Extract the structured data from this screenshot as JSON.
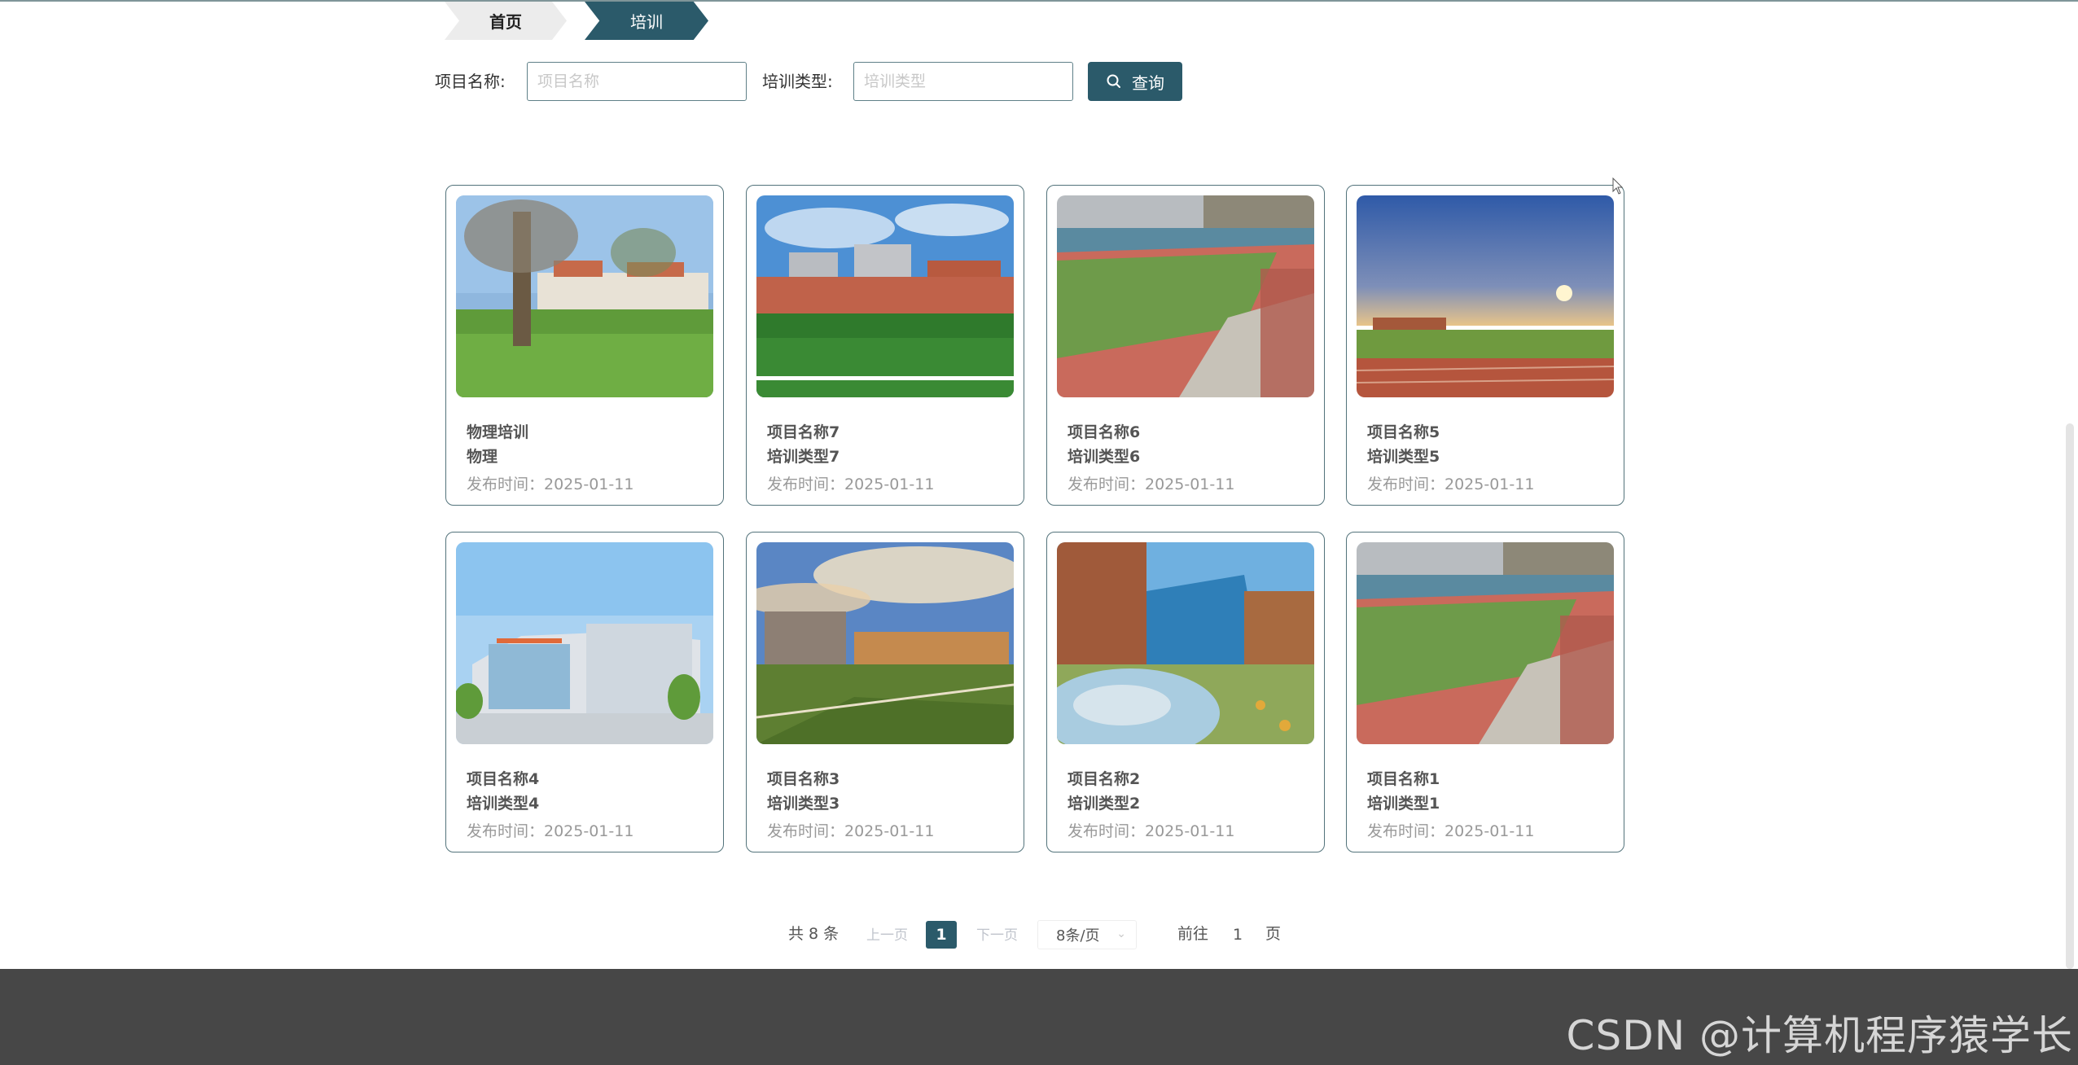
{
  "breadcrumb": {
    "home": "首页",
    "current": "培训"
  },
  "search": {
    "project_label": "项目名称:",
    "project_placeholder": "项目名称",
    "type_label": "培训类型:",
    "type_placeholder": "培训类型",
    "button_label": "查询"
  },
  "cards": [
    {
      "title": "物理培训",
      "type": "物理",
      "date": "发布时间：2025-01-11",
      "image": "campus-tree-lawn"
    },
    {
      "title": "项目名称7",
      "type": "培训类型7",
      "date": "发布时间：2025-01-11",
      "image": "campus-building-field"
    },
    {
      "title": "项目名称6",
      "type": "培训类型6",
      "date": "发布时间：2025-01-11",
      "image": "stadium-track"
    },
    {
      "title": "项目名称5",
      "type": "培训类型5",
      "date": "发布时间：2025-01-11",
      "image": "sunset-track"
    },
    {
      "title": "项目名称4",
      "type": "培训类型4",
      "date": "发布时间：2025-01-11",
      "image": "modern-building"
    },
    {
      "title": "项目名称3",
      "type": "培训类型3",
      "date": "发布时间：2025-01-11",
      "image": "campus-field-dusk"
    },
    {
      "title": "项目名称2",
      "type": "培训类型2",
      "date": "发布时间：2025-01-11",
      "image": "autumn-campus"
    },
    {
      "title": "项目名称1",
      "type": "培训类型1",
      "date": "发布时间：2025-01-11",
      "image": "stadium-track"
    }
  ],
  "pagination": {
    "total": "共 8 条",
    "prev": "上一页",
    "current_page": "1",
    "next": "下一页",
    "page_size": "8条/页",
    "goto_label": "前往",
    "goto_value": "1",
    "page_suffix": "页"
  },
  "footer": {
    "watermark": "CSDN @计算机程序猿学长"
  },
  "colors": {
    "primary": "#2b5a6a",
    "card_border": "#53737b",
    "footer_bg": "#474747"
  },
  "icons": {
    "search_button_icon": "search-icon",
    "page_size_chevron": "chevron-down-icon"
  }
}
